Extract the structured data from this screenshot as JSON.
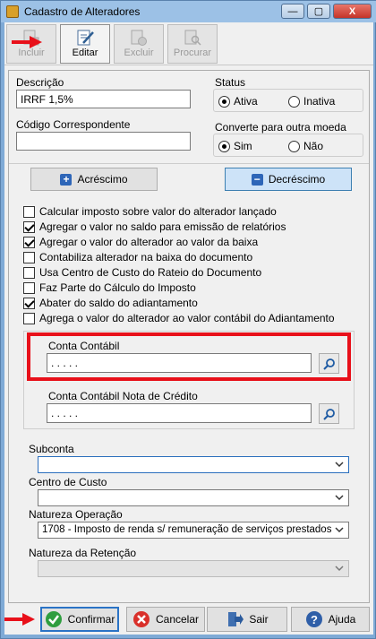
{
  "window": {
    "title": "Cadastro de Alteradores",
    "minimize": "—",
    "maximize": "▢",
    "close": "X"
  },
  "toolbar": {
    "incluir": "Incluir",
    "editar": "Editar",
    "excluir": "Excluir",
    "procurar": "Procurar"
  },
  "form": {
    "descricao_label": "Descrição",
    "descricao_value": "IRRF 1,5%",
    "codigo_label": "Código Correspondente",
    "codigo_value": "",
    "status": {
      "title": "Status",
      "ativa": "Ativa",
      "inativa": "Inativa",
      "selected": "Ativa"
    },
    "moeda": {
      "title": "Converte para outra moeda",
      "sim": "Sim",
      "nao": "Não",
      "selected": "Sim"
    },
    "acrescimo": "Acréscimo",
    "decrescimo": "Decréscimo",
    "checks": [
      {
        "label": "Calcular imposto sobre valor do alterador lançado",
        "checked": false
      },
      {
        "label": "Agregar o valor no saldo para emissão de relatórios",
        "checked": true
      },
      {
        "label": "Agregar o valor do alterador ao valor da baixa",
        "checked": true
      },
      {
        "label": "Contabiliza alterador na baixa do documento",
        "checked": false
      },
      {
        "label": "Usa Centro de Custo do Rateio do Documento",
        "checked": false
      },
      {
        "label": "Faz Parte do Cálculo do Imposto",
        "checked": false
      },
      {
        "label": "Abater do saldo do adiantamento",
        "checked": true
      },
      {
        "label": "Agrega o valor do alterador ao valor contábil do Adiantamento",
        "checked": false
      }
    ],
    "conta_contabil_label": "Conta Contábil",
    "conta_contabil_value": ". . . . .",
    "conta_nota_label": "Conta Contábil Nota de Crédito",
    "conta_nota_value": ". . . . .",
    "subconta_label": "Subconta",
    "subconta_value": "",
    "centro_custo_label": "Centro de Custo",
    "centro_custo_value": "",
    "natureza_op_label": "Natureza Operação",
    "natureza_op_value": "1708 - Imposto de renda s/ remuneração de serviços prestados",
    "natureza_ret_label": "Natureza da Retenção",
    "natureza_ret_value": ""
  },
  "footer": {
    "confirmar": "Confirmar",
    "cancelar": "Cancelar",
    "sair": "Sair",
    "ajuda": "Ajuda"
  },
  "colors": {
    "highlight": "#e8101a",
    "accent": "#2a73c5"
  }
}
